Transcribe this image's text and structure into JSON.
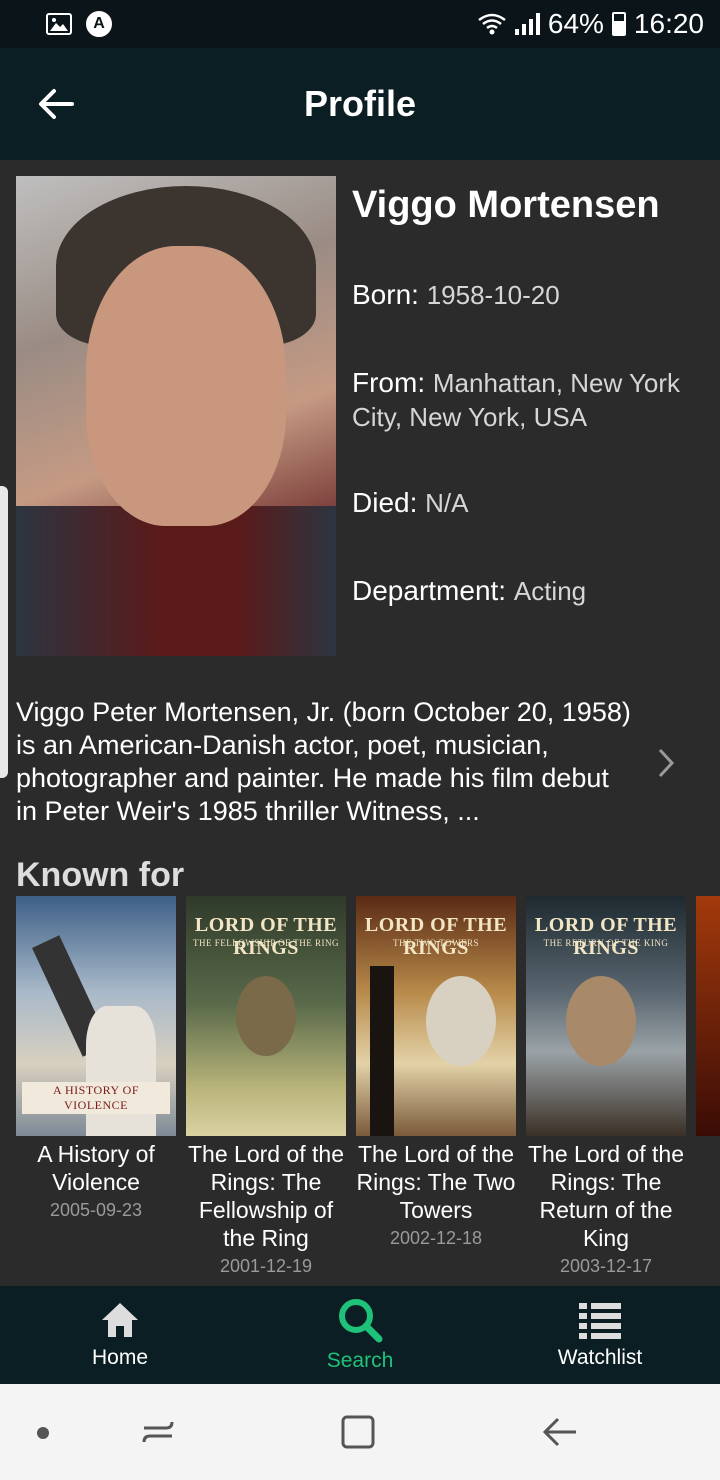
{
  "status_bar": {
    "battery": "64%",
    "time": "16:20",
    "battery_level": 0.64,
    "left_icons": [
      "gallery-icon",
      "a-badge-icon"
    ],
    "right_icons": [
      "wifi-icon",
      "signal-icon",
      "battery-icon"
    ]
  },
  "app_bar": {
    "title": "Profile",
    "back_icon": "arrow-left-icon"
  },
  "profile": {
    "name": "Viggo Mortensen",
    "born_label": "Born:",
    "born_value": "1958-10-20",
    "from_label": "From:",
    "from_value": "Manhattan, New York City, New York, USA",
    "died_label": "Died:",
    "died_value": "N/A",
    "department_label": "Department:",
    "department_value": "Acting",
    "bio": "Viggo Peter Mortensen, Jr. (born October 20, 1958) is an American-Danish actor, poet, musician, photographer and painter. He made his film debut in Peter Weir's 1985 thriller Witness, ..."
  },
  "known_for": {
    "title": "Known for",
    "items": [
      {
        "title": "A History of Violence",
        "date": "2005-09-23",
        "poster_text": "A HISTORY OF VIOLENCE"
      },
      {
        "title": "The Lord of the Rings: The Fellowship of the Ring",
        "date": "2001-12-19",
        "poster_text": "LORD OF THE RINGS",
        "poster_sub": "THE FELLOWSHIP OF THE RING"
      },
      {
        "title": "The Lord of the Rings: The Two Towers",
        "date": "2002-12-18",
        "poster_text": "LORD OF THE RINGS",
        "poster_sub": "THE TWO TOWERS"
      },
      {
        "title": "The Lord of the Rings: The Return of the King",
        "date": "2003-12-17",
        "poster_text": "LORD OF THE RINGS",
        "poster_sub": "THE RETURN OF THE KING"
      }
    ]
  },
  "bottom_nav": {
    "items": [
      {
        "label": "Home",
        "icon": "home-icon",
        "active": false
      },
      {
        "label": "Search",
        "icon": "search-icon",
        "active": true
      },
      {
        "label": "Watchlist",
        "icon": "list-icon",
        "active": false
      }
    ],
    "active_color": "#1ec27a"
  },
  "system_nav": {
    "buttons": [
      "dot-icon",
      "recent-apps-icon",
      "home-square-icon",
      "back-icon"
    ]
  }
}
